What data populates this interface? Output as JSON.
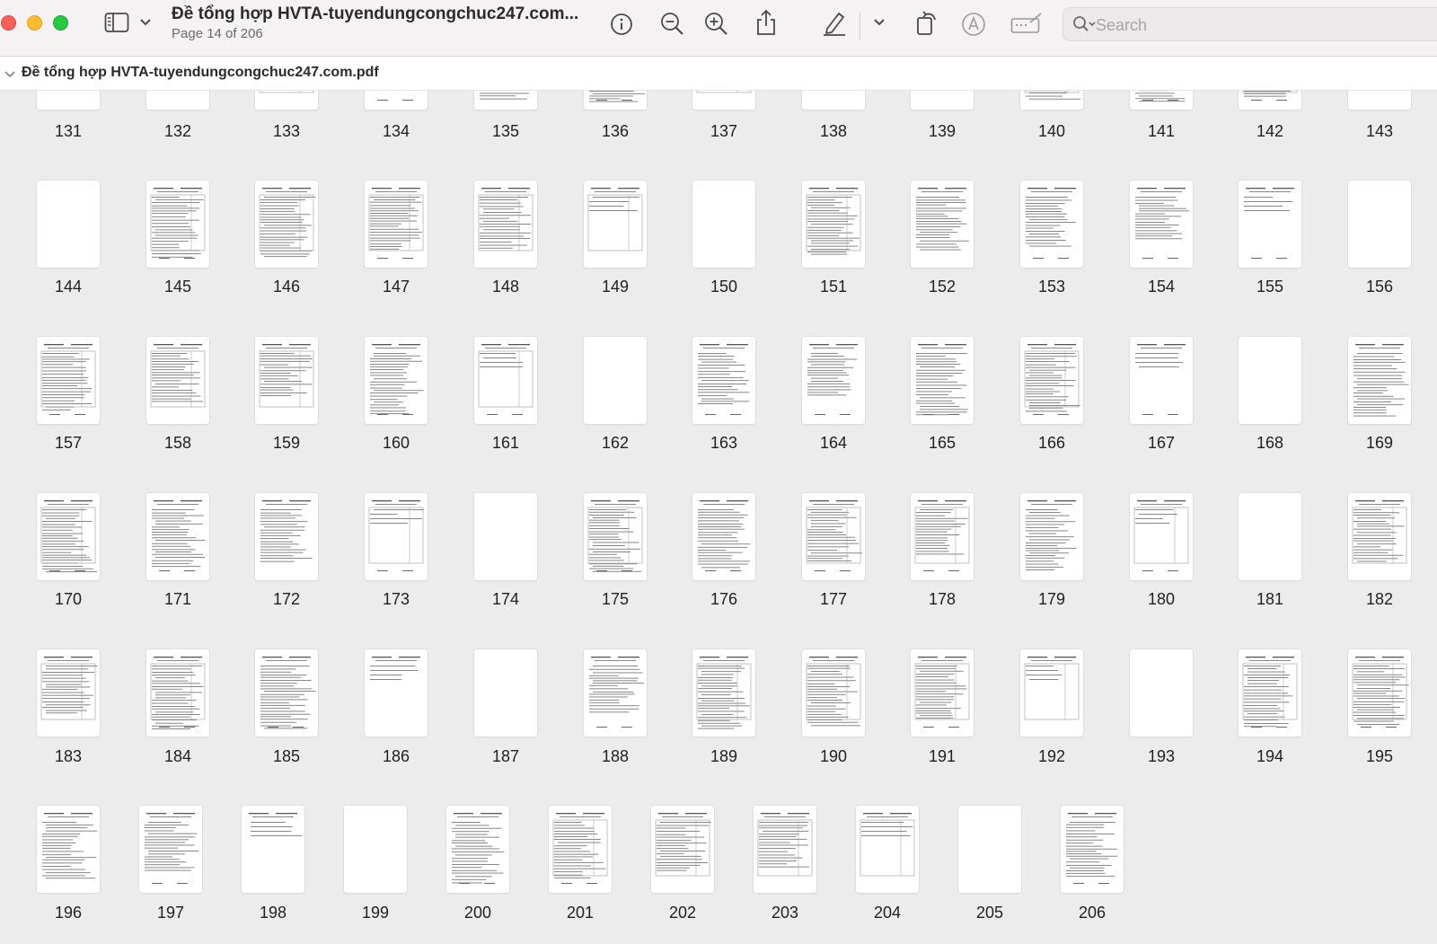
{
  "toolbar": {
    "title": "Đề tổng hợp HVTA-tuyendungcongchuc247.com...",
    "subtitle": "Page 14 of 206",
    "search_placeholder": "Search",
    "icons": [
      "sidebar-icon",
      "chevron-down-icon",
      "info-icon",
      "zoom-out-icon",
      "zoom-in-icon",
      "share-icon",
      "markup-pen-icon",
      "chevron-down-icon",
      "rotate-icon",
      "markup-icon",
      "signature-icon",
      "search-icon"
    ]
  },
  "sidebar": {
    "title": "Đề tổng hợp HVTA-tuyendungcongchuc247.com.pdf"
  },
  "thumbnails": {
    "rows": [
      [
        "131",
        "132",
        "133",
        "134",
        "135",
        "136",
        "137",
        "138",
        "139",
        "140",
        "141",
        "142",
        "143"
      ],
      [
        "144",
        "145",
        "146",
        "147",
        "148",
        "149",
        "150",
        "151",
        "152",
        "153",
        "154",
        "155",
        "156"
      ],
      [
        "157",
        "158",
        "159",
        "160",
        "161",
        "162",
        "163",
        "164",
        "165",
        "166",
        "167",
        "168",
        "169"
      ],
      [
        "170",
        "171",
        "172",
        "173",
        "174",
        "175",
        "176",
        "177",
        "178",
        "179",
        "180",
        "181",
        "182"
      ],
      [
        "183",
        "184",
        "185",
        "186",
        "187",
        "188",
        "189",
        "190",
        "191",
        "192",
        "193",
        "194",
        "195"
      ],
      [
        "196",
        "197",
        "198",
        "199",
        "200",
        "201",
        "202",
        "203",
        "204",
        "205",
        "206"
      ]
    ]
  },
  "colors": {
    "close": "#fe5f57",
    "minimize": "#febc2e",
    "maximize": "#28c840"
  }
}
